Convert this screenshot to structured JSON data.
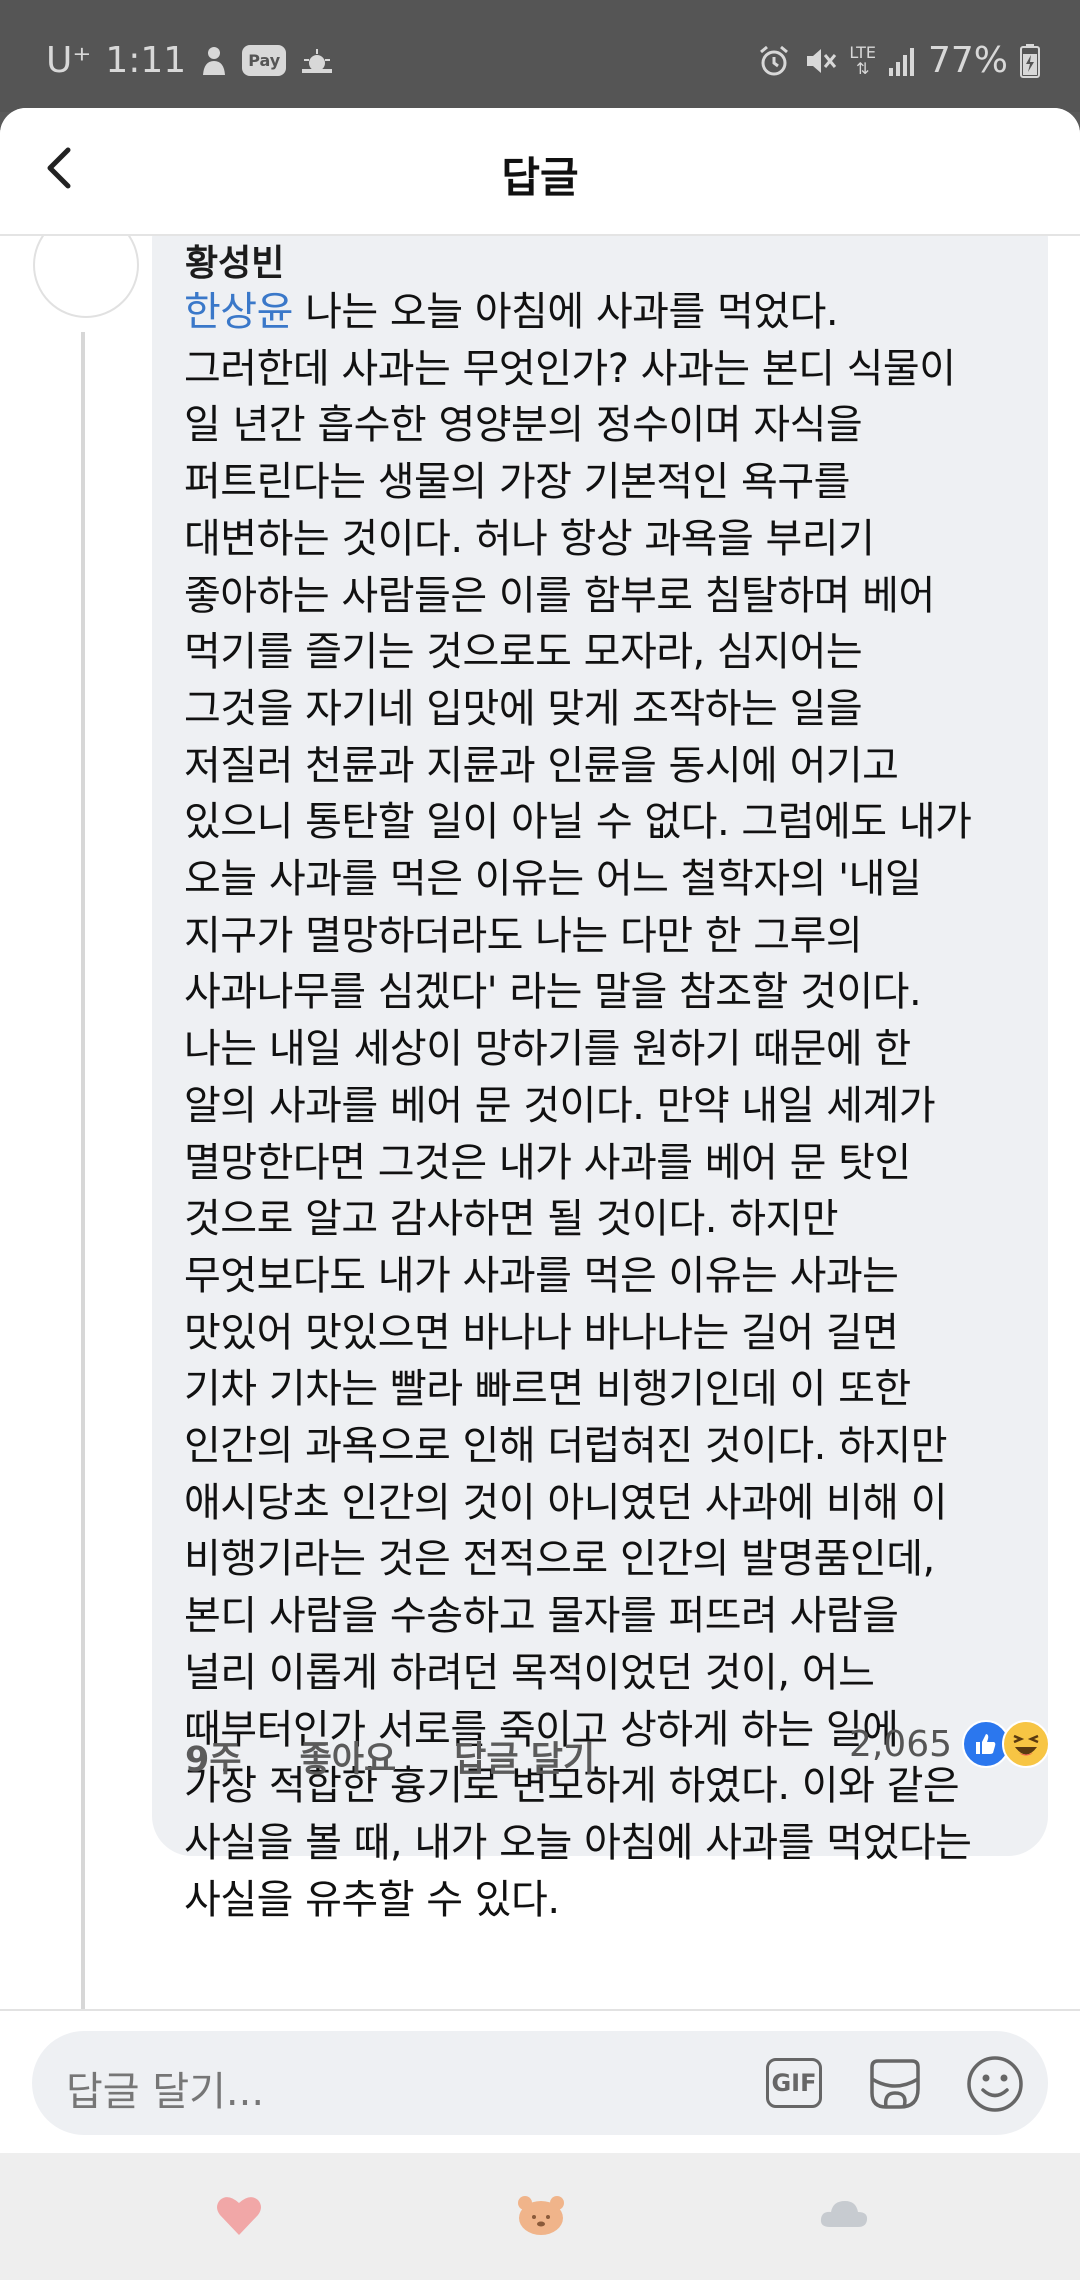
{
  "status_bar": {
    "carrier": "U⁺",
    "time": "1:11",
    "pay_label": "Pay",
    "network": "LTE",
    "battery": "77%"
  },
  "header": {
    "title": "답글"
  },
  "comment": {
    "author": "황성빈",
    "mention": "한상윤",
    "text": " 나는 오늘 아침에 사과를 먹었다.\n그러한데 사과는 무엇인가? 사과는 본디 식물이\n일 년간 흡수한 영양분의 정수이며 자식을\n퍼트린다는 생물의 가장 기본적인 욕구를\n대변하는 것이다. 허나 항상 과욕을 부리기\n좋아하는 사람들은 이를 함부로 침탈하며 베어\n먹기를 즐기는 것으로도 모자라, 심지어는\n그것을 자기네 입맛에 맞게 조작하는 일을\n저질러 천륜과 지륜과 인륜을 동시에 어기고\n있으니 통탄할 일이 아닐 수 없다. 그럼에도 내가\n오늘 사과를 먹은 이유는 어느 철학자의 '내일\n지구가 멸망하더라도 나는 다만 한 그루의\n사과나무를 심겠다' 라는 말을 참조할 것이다.\n나는 내일 세상이 망하기를 원하기 때문에 한\n알의 사과를 베어 문 것이다. 만약 내일 세계가\n멸망한다면 그것은 내가 사과를 베어 문 탓인\n것으로 알고 감사하면 될 것이다. 하지만\n무엇보다도 내가 사과를 먹은 이유는 사과는\n맛있어 맛있으면 바나나 바나나는 길어 길면\n기차 기차는 빨라 빠르면 비행기인데 이 또한\n인간의 과욕으로 인해 더럽혀진 것이다. 하지만\n애시당초 인간의 것이 아니였던 사과에 비해 이\n비행기라는 것은 전적으로 인간의 발명품인데,\n본디 사람을 수송하고 물자를 퍼뜨려 사람을\n널리 이롭게 하려던 목적이었던 것이, 어느\n때부터인가 서로를 죽이고 상하게 하는 일에\n가장 적합한 흉기로 변모하게 하였다. 이와 같은\n사실을 볼 때, 내가 오늘 아침에 사과를 먹었다는\n사실을 유추할 수 있다.",
    "time_ago": "9주",
    "like_label": "좋아요",
    "reply_label": "답글 달기",
    "reaction_count": "2,065"
  },
  "composer": {
    "placeholder": "답글 달기...",
    "gif_label": "GIF"
  },
  "colors": {
    "mention": "#3a78c9",
    "bubble_bg": "#eef0f3",
    "like_blue": "#2b77ee",
    "haha_yellow": "#f7c544",
    "nav_heart": "#f1a7a7",
    "nav_face": "#f0b48a",
    "nav_cloud": "#c7cbd0"
  },
  "nav_icons": [
    "heart-icon",
    "bear-face-icon",
    "cloud-icon"
  ]
}
